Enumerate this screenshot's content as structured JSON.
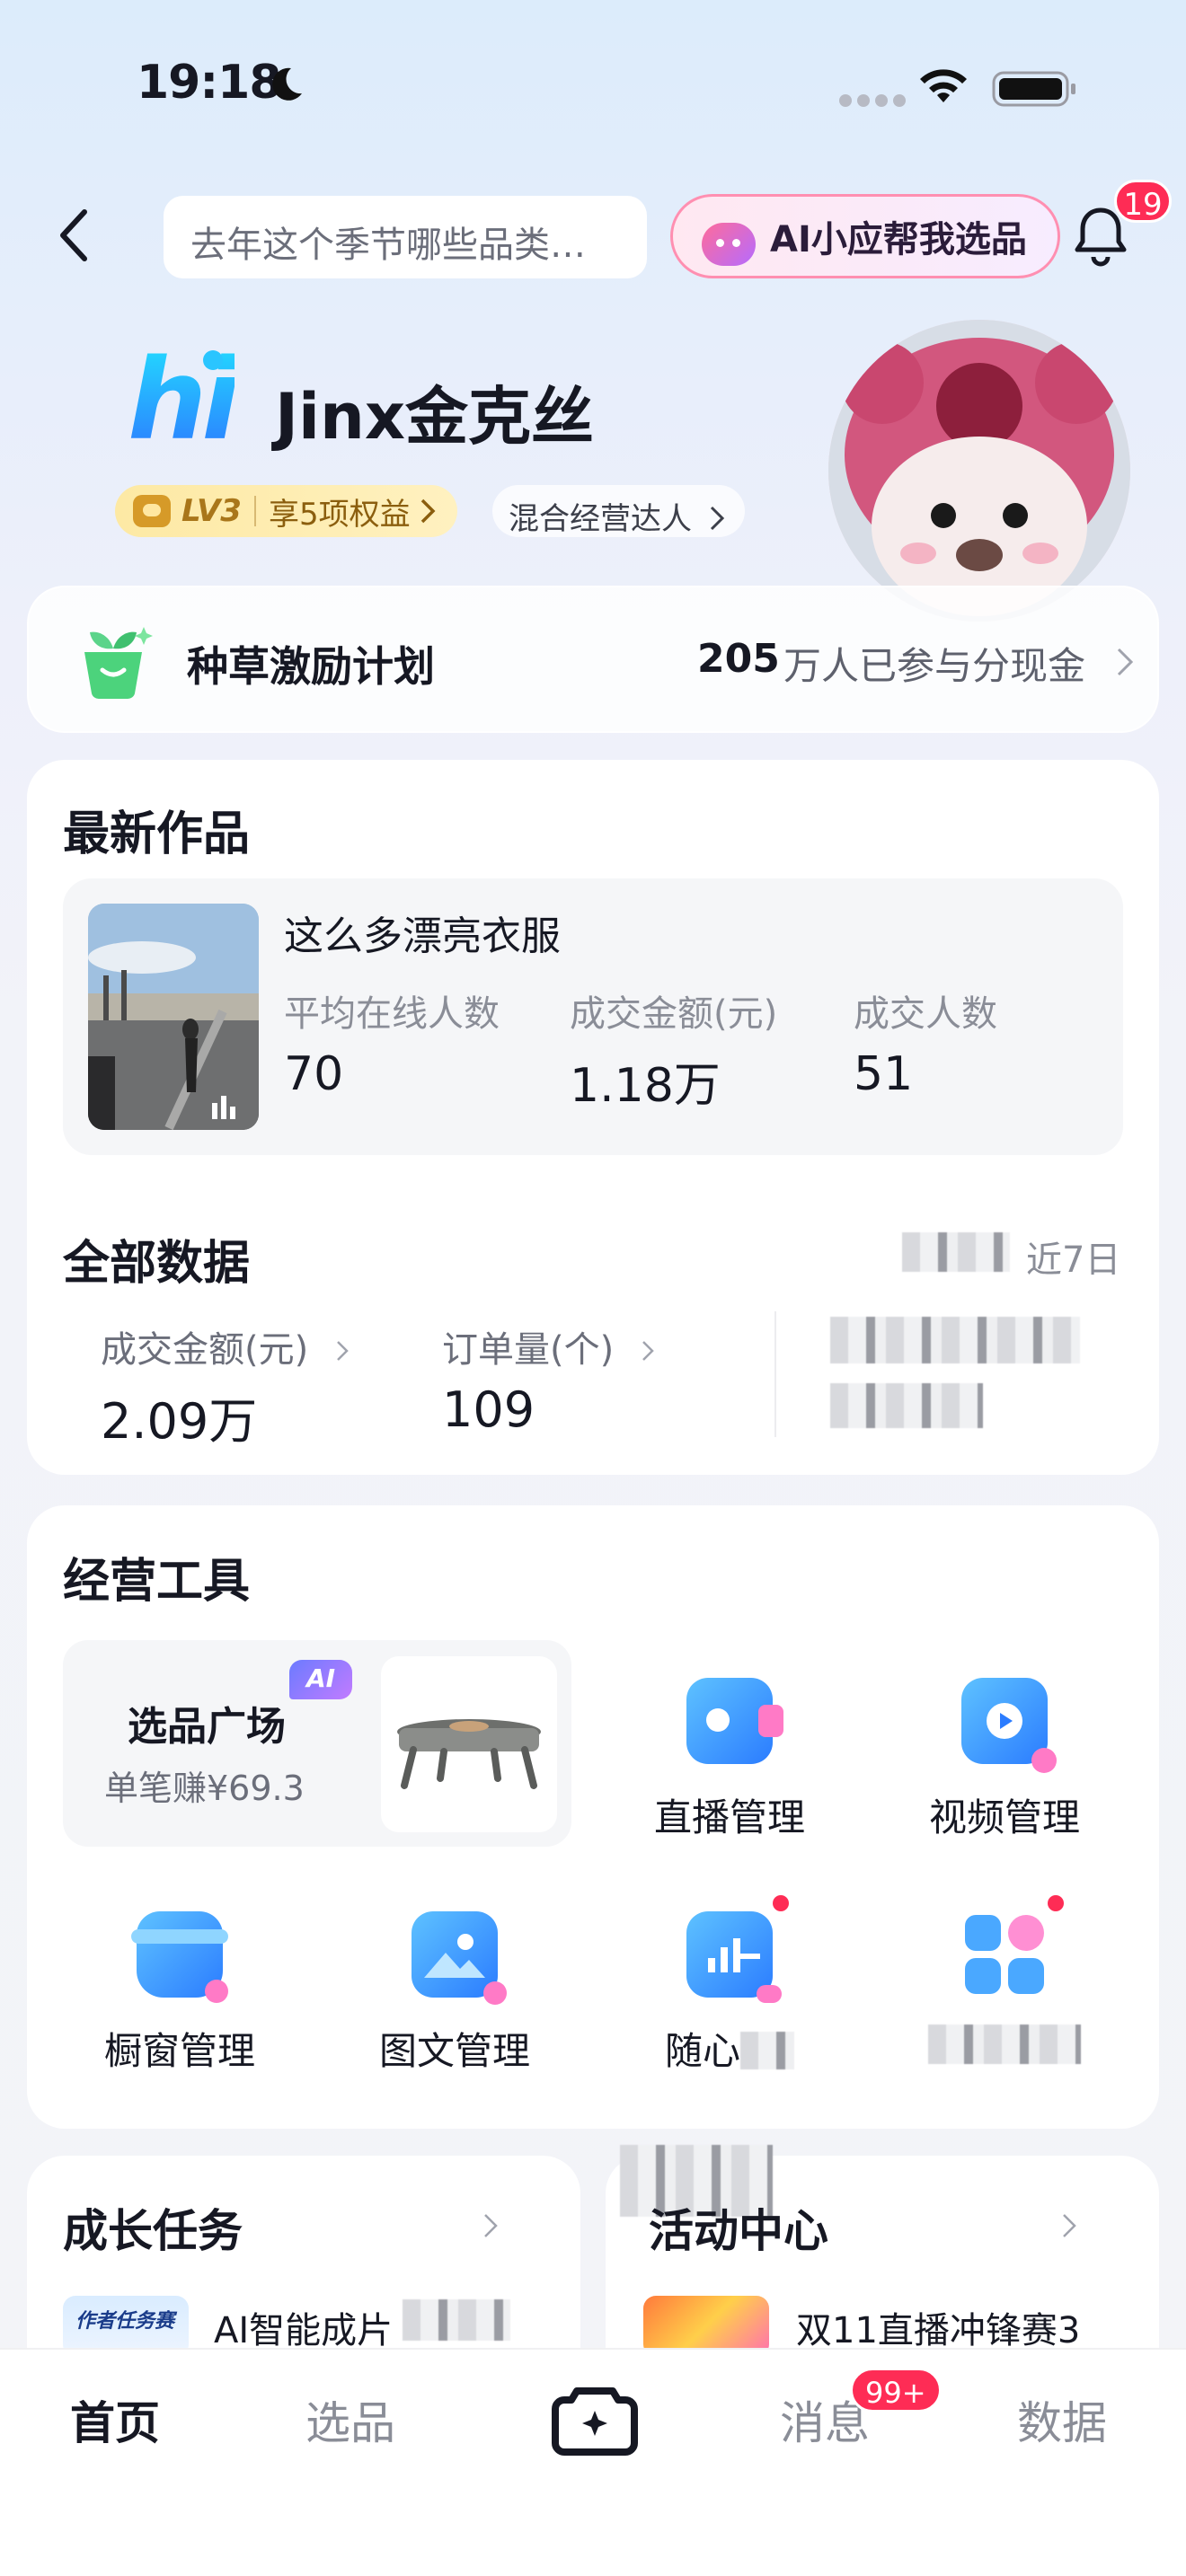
{
  "status_bar": {
    "time": "19:18"
  },
  "header": {
    "search_placeholder": "去年这个季节哪些品类…",
    "ai_button": "AI小应帮我选品",
    "bell_badge": "19"
  },
  "profile": {
    "greeting": "hi",
    "name": "Jinx金克丝",
    "level": "LV3",
    "benefits": "享5项权益",
    "tag": "混合经营达人"
  },
  "incentive": {
    "title": "种草激励计划",
    "count": "205",
    "desc": "万人已参与分现金"
  },
  "latest_works": {
    "title": "最新作品",
    "item_title": "这么多漂亮衣服",
    "metrics": [
      {
        "label": "平均在线人数",
        "value": "70"
      },
      {
        "label": "成交金额(元)",
        "value": "1.18万"
      },
      {
        "label": "成交人数",
        "value": "51"
      }
    ]
  },
  "all_data": {
    "title": "全部数据",
    "range": "近7日",
    "metrics": [
      {
        "label": "成交金额(元)",
        "value": "2.09万"
      },
      {
        "label": "订单量(个)",
        "value": "109"
      }
    ]
  },
  "tools": {
    "title": "经营工具",
    "market_title": "选品广场",
    "market_sub": "单笔赚¥69.3",
    "ai_tag": "AI",
    "items": [
      {
        "label": "直播管理"
      },
      {
        "label": "视频管理"
      },
      {
        "label": "橱窗管理"
      },
      {
        "label": "图文管理"
      },
      {
        "label": "随心"
      }
    ]
  },
  "growth": {
    "title": "成长任务",
    "row": "AI智能成片",
    "thumb_text": "作者任务赛"
  },
  "activity": {
    "title": "活动中心",
    "row": "双11直播冲锋赛3"
  },
  "tabbar": {
    "tabs": [
      "首页",
      "选品",
      "消息",
      "数据"
    ],
    "message_badge": "99+"
  },
  "colors": {
    "accent": "#fe2c55",
    "text": "#161823",
    "muted": "#8a8d97"
  }
}
